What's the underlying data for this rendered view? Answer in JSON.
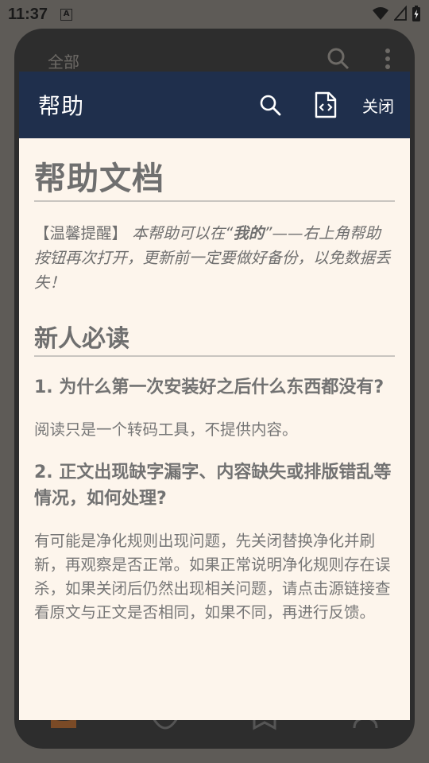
{
  "status_bar": {
    "time": "11:37",
    "a_icon_letter": "A"
  },
  "background_app": {
    "header_label": "全部"
  },
  "dialog": {
    "title": "帮助",
    "close_label": "关闭",
    "doc_title": "帮助文档",
    "tip_prefix": "【温馨提醒】",
    "tip_part1": "本帮助可以在“",
    "tip_bold": "我的",
    "tip_part2": "”——右上角帮助按钮再次打开，更新前一定要做好备份，以免数据丢失！",
    "section_title": "新人必读",
    "q1": "1. 为什么第一次安装好之后什么东西都没有?",
    "a1": "阅读只是一个转码工具，不提供内容。",
    "q2": "2. 正文出现缺字漏字、内容缺失或排版错乱等情况，如何处理?",
    "a2": "有可能是净化规则出现问题，先关闭替换净化并刷新，再观察是否正常。如果正常说明净化规则存在误杀，如果关闭后仍然出现相关问题，请点击源链接查看原文与正文是否相同，如果不同，再进行反馈。"
  },
  "colors": {
    "header_bg": "#1f2f4c",
    "dialog_bg": "#fdf5ec",
    "scrim": "#5e5b57"
  }
}
